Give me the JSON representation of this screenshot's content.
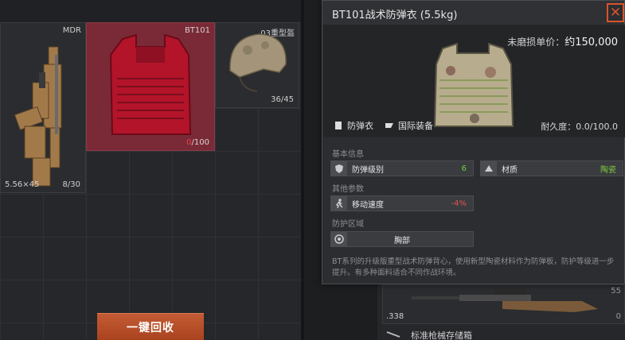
{
  "stash": {
    "rifle": {
      "name": "MDR",
      "ammo": "5.56×45",
      "count": "8/30"
    },
    "vest": {
      "name": "BT101",
      "durability_current": "0",
      "durability_max": "/100"
    },
    "helmet": {
      "name": "03重型盔",
      "count": "36/45"
    },
    "recycle_button": "一键回收"
  },
  "tooltip": {
    "title": "BT101战术防弹衣 (5.5kg)",
    "close_icon": "close-icon",
    "price_label": "未磨损单价：",
    "price_value": "约150,000",
    "category": "防弹衣",
    "faction": "国际装备",
    "durability_label": "耐久度：",
    "durability_value": "0.0/100.0",
    "sections": {
      "basic": "基本信息",
      "other": "其他参数",
      "protection": "防护区域"
    },
    "stats": {
      "armor_level_label": "防弹级别",
      "armor_level_value": "6",
      "material_label": "材质",
      "material_value": "陶瓷",
      "move_speed_label": "移动速度",
      "move_speed_value": "-4%",
      "zone_label": "胸部"
    },
    "description": "BT系列的升级版重型战术防弹背心，使用新型陶瓷材料作为防弹板，防护等级进一步提升。有多种面料适合不同作战环境。"
  },
  "background": {
    "rifle_ammo": ".338",
    "rifle_count_top": "55",
    "rifle_count_bottom": "0",
    "next_item_label": "标准枪械存储箱"
  },
  "colors": {
    "accent": "#d9542b",
    "positive": "#7ec93e",
    "negative": "#e0554a",
    "vest_slot": "#7a2a36"
  }
}
